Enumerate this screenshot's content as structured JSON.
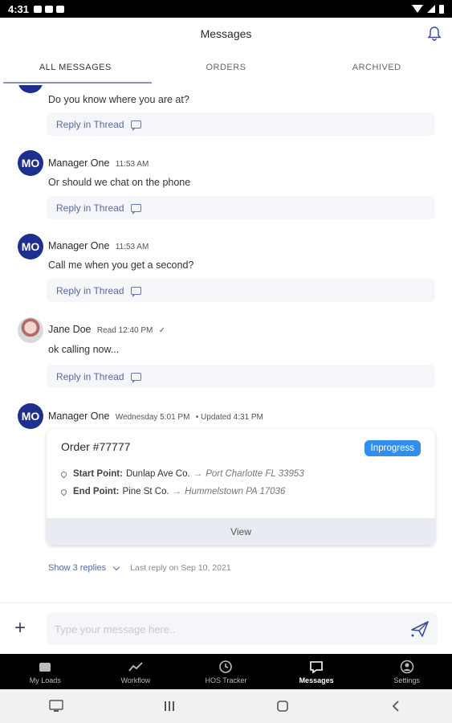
{
  "status_bar": {
    "time": "4:31"
  },
  "header": {
    "title": "Messages"
  },
  "tabs": [
    {
      "label": "ALL MESSAGES"
    },
    {
      "label": "ORDERS"
    },
    {
      "label": "ARCHIVED"
    }
  ],
  "messages": [
    {
      "text": "Do you know where you are at?",
      "reply_label": "Reply in Thread"
    },
    {
      "avatar": "MO",
      "name": "Manager One",
      "time": "11:53 AM",
      "text": "Or should we chat on the phone",
      "reply_label": "Reply in Thread"
    },
    {
      "avatar": "MO",
      "name": "Manager One",
      "time": "11:53 AM",
      "text": "Call me when you get a second?",
      "reply_label": "Reply in Thread"
    },
    {
      "name": "Jane Doe",
      "time": "Read 12:40 PM",
      "text": "ok calling now...",
      "reply_label": "Reply in Thread"
    },
    {
      "avatar": "MO",
      "name": "Manager One",
      "time": "Wednesday 5:01 PM",
      "updated": "• Updated 4:31 PM",
      "order": {
        "title": "Order #77777",
        "status": "Inprogress",
        "start_label": "Start Point:",
        "start_value": "Dunlap Ave Co.",
        "start_dest": "Port Charlotte FL 33953",
        "end_label": "End Point:",
        "end_value": "Pine St Co.",
        "end_dest": "Hummelstown PA 17036",
        "view_label": "View"
      },
      "show_replies": "Show 3 replies",
      "last_reply": "Last reply on Sep 10, 2021"
    }
  ],
  "composer": {
    "placeholder": "Type your message here..",
    "plus": "+"
  },
  "bottom_nav": [
    {
      "label": "My Loads"
    },
    {
      "label": "Workflow"
    },
    {
      "label": "HOS Tracker"
    },
    {
      "label": "Messages",
      "active": true
    },
    {
      "label": "Settings"
    }
  ],
  "colors": {
    "accent": "#1e2f8f",
    "badge": "#2f8ef0",
    "link": "#5a67a8"
  }
}
